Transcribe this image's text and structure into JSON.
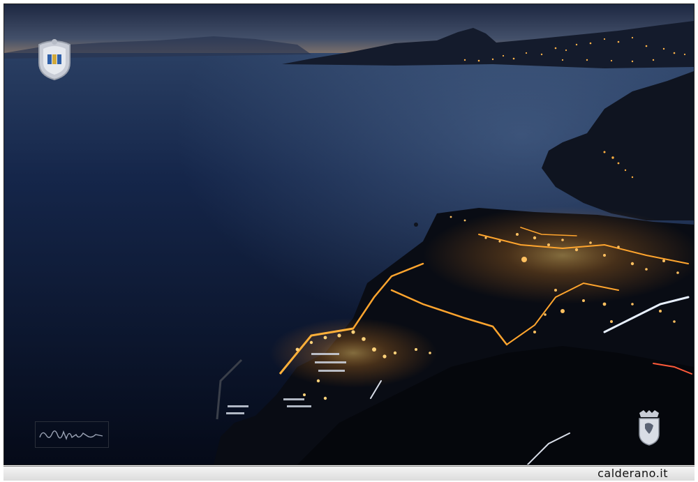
{
  "footer": {
    "site": "calderano.it"
  },
  "icons": {
    "crest": "town-crest-icon",
    "signature": "photographer-signature",
    "coat": "coat-of-arms-icon"
  },
  "colors": {
    "sky_top": "#1f2a44",
    "sky_horizon": "#c79a6b",
    "sea": "#0b1730",
    "lights": "#ffb23a"
  }
}
